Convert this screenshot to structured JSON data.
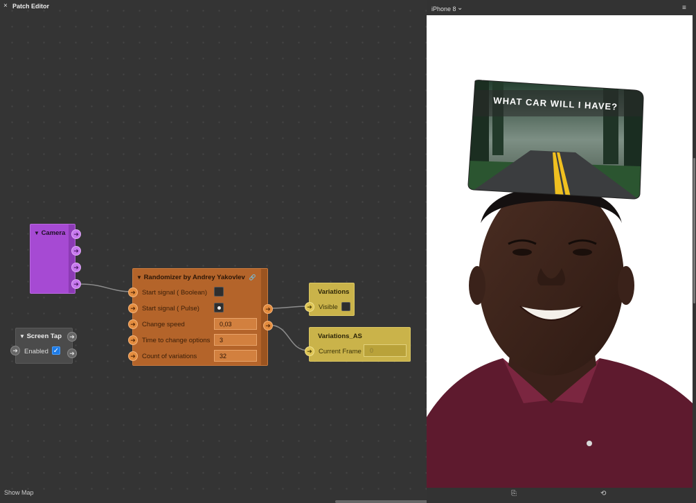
{
  "patch_editor": {
    "close_glyph": "×",
    "title": "Patch Editor",
    "show_map": "Show Map"
  },
  "nodes": {
    "camera": {
      "title": "Camera"
    },
    "screen_tap": {
      "title": "Screen Tap",
      "enabled_label": "Enabled",
      "enabled_checked": true
    },
    "randomizer": {
      "title": "Randomizer by Andrey Yakovlev",
      "inputs": [
        {
          "label": "Start signal ( Boolean)",
          "value": ""
        },
        {
          "label": "Start signal ( Pulse)",
          "value": ""
        },
        {
          "label": "Change speed",
          "value": "0,03"
        },
        {
          "label": "Time to change options",
          "value": "3"
        },
        {
          "label": "Count of variations",
          "value": "32"
        }
      ]
    },
    "variations": {
      "title": "Variations",
      "visible_label": "Visible"
    },
    "variations_as": {
      "title": "Variations_AS",
      "current_frame_label": "Current Frame",
      "current_frame_value": "0"
    }
  },
  "preview": {
    "device": "iPhone 8",
    "card_title": "WHAT CAR WILL I HAVE?"
  },
  "colors": {
    "camera": "#a64ad3",
    "randomizer": "#b4642a",
    "yellow": "#cab34a",
    "checkbox": "#1e7be6"
  },
  "icons": [
    "close-icon",
    "chevron-down-icon",
    "hamburger-menu-icon",
    "arrow-right-icon",
    "camera-switch-icon",
    "rotate-icon",
    "link-icon",
    "checkmark-icon"
  ]
}
